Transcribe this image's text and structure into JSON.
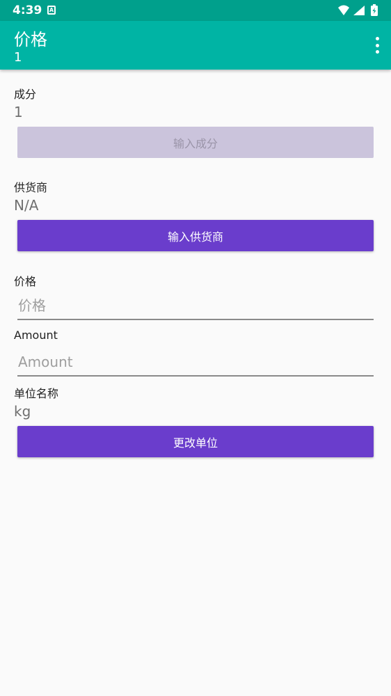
{
  "status": {
    "time": "4:39",
    "badge": "A"
  },
  "appbar": {
    "title": "价格",
    "subtitle": "1"
  },
  "ingredient": {
    "label": "成分",
    "value": "1",
    "button": "输入成分"
  },
  "supplier": {
    "label": "供货商",
    "value": "N/A",
    "button": "输入供货商"
  },
  "price": {
    "label": "价格",
    "placeholder": "价格"
  },
  "amount": {
    "label": "Amount",
    "placeholder": "Amount"
  },
  "unit": {
    "label": "单位名称",
    "value": "kg",
    "button": "更改单位"
  },
  "colors": {
    "statusbar": "#00a08c",
    "appbar": "#00b4a4",
    "accent": "#6a3dcc",
    "disabled": "#cbc4dc"
  }
}
